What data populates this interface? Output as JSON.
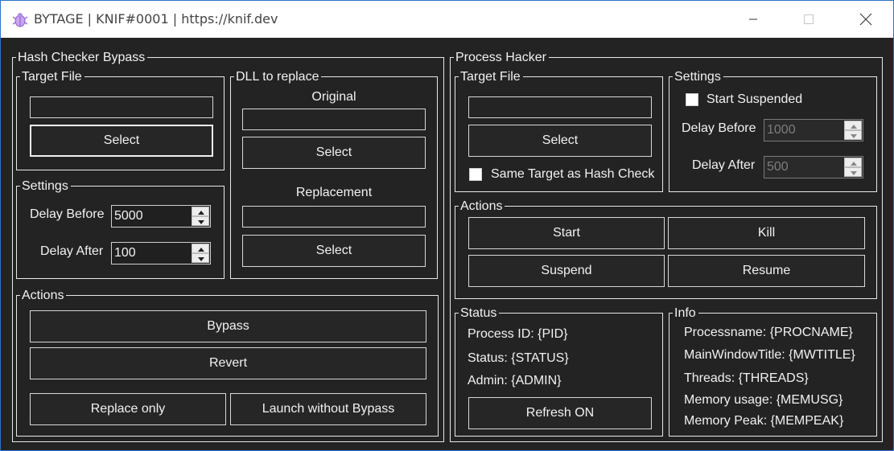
{
  "window": {
    "title": "BYTAGE | KNIF#0001 | https://knif.dev",
    "icons": {
      "app": "bug-icon",
      "minimize": "minimize-icon",
      "maximize": "maximize-icon",
      "close": "close-icon"
    }
  },
  "hash_checker": {
    "title": "Hash Checker Bypass",
    "target_file": {
      "title": "Target File",
      "path_value": "",
      "select_label": "Select"
    },
    "settings": {
      "title": "Settings",
      "delay_before_label": "Delay Before",
      "delay_before_value": "5000",
      "delay_after_label": "Delay After",
      "delay_after_value": "100"
    },
    "dll": {
      "title": "DLL to replace",
      "original_label": "Original",
      "original_value": "",
      "original_select": "Select",
      "replacement_label": "Replacement",
      "replacement_value": "",
      "replacement_select": "Select"
    },
    "actions": {
      "title": "Actions",
      "bypass": "Bypass",
      "revert": "Revert",
      "replace_only": "Replace only",
      "launch_without_bypass": "Launch without Bypass"
    }
  },
  "process_hacker": {
    "title": "Process Hacker",
    "target_file": {
      "title": "Target File",
      "path_value": "",
      "select_label": "Select",
      "same_target_label": "Same Target as Hash Check",
      "same_target_checked": false
    },
    "settings": {
      "title": "Settings",
      "start_suspended_label": "Start Suspended",
      "start_suspended_checked": false,
      "delay_before_label": "Delay Before",
      "delay_before_value": "1000",
      "delay_after_label": "Delay After",
      "delay_after_value": "500"
    },
    "actions": {
      "title": "Actions",
      "start": "Start",
      "kill": "Kill",
      "suspend": "Suspend",
      "resume": "Resume"
    },
    "status": {
      "title": "Status",
      "process_id": "Process ID: {PID}",
      "status": "Status: {STATUS}",
      "admin": "Admin: {ADMIN}",
      "refresh": "Refresh ON"
    },
    "info": {
      "title": "Info",
      "processname": "Processname: {PROCNAME}",
      "mainwindowtitle": "MainWindowTitle: {MWTITLE}",
      "threads": "Threads: {THREADS}",
      "memory_usage": "Memory usage: {MEMUSG}",
      "memory_peak": "Memory Peak: {MEMPEAK}"
    }
  }
}
